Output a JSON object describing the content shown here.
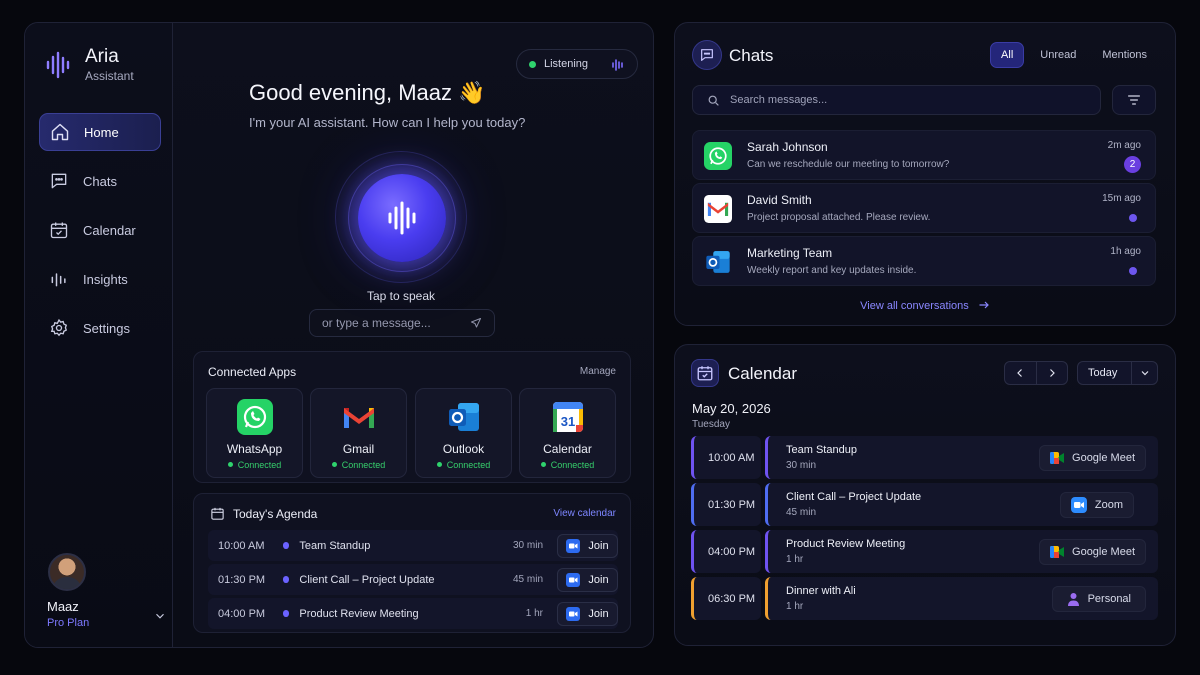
{
  "brand": {
    "name": "Aria",
    "subtitle": "Assistant"
  },
  "nav": [
    {
      "label": "Home",
      "icon": "home-icon",
      "active": true
    },
    {
      "label": "Chats",
      "icon": "chat-icon"
    },
    {
      "label": "Calendar",
      "icon": "calendar-icon"
    },
    {
      "label": "Insights",
      "icon": "bar-chart-icon"
    },
    {
      "label": "Settings",
      "icon": "gear-icon"
    }
  ],
  "user": {
    "name": "Maaz",
    "plan": "Pro Plan"
  },
  "status": {
    "label": "Listening",
    "color": "#2fd36d"
  },
  "greeting": {
    "title": "Good evening, Maaz 👋",
    "subtitle": "I'm your AI assistant. How can I help you today?"
  },
  "voice": {
    "tap_label": "Tap to speak",
    "input_placeholder": "or type a message..."
  },
  "connected_apps": {
    "title": "Connected Apps",
    "manage": "Manage",
    "apps": [
      {
        "name": "WhatsApp",
        "status": "Connected",
        "icon": "whatsapp-icon"
      },
      {
        "name": "Gmail",
        "status": "Connected",
        "icon": "gmail-icon"
      },
      {
        "name": "Outlook",
        "status": "Connected",
        "icon": "outlook-icon"
      },
      {
        "name": "Calendar",
        "status": "Connected",
        "icon": "google-calendar-icon",
        "icon_text": "31"
      }
    ]
  },
  "agenda": {
    "title": "Today's Agenda",
    "link": "View calendar",
    "items": [
      {
        "time": "10:00 AM",
        "title": "Team Standup",
        "duration": "30 min",
        "action": "Join"
      },
      {
        "time": "01:30 PM",
        "title": "Client Call – Project Update",
        "duration": "45 min",
        "action": "Join"
      },
      {
        "time": "04:00 PM",
        "title": "Product Review Meeting",
        "duration": "1 hr",
        "action": "Join"
      }
    ]
  },
  "chats": {
    "title": "Chats",
    "tabs": [
      "All",
      "Unread",
      "Mentions"
    ],
    "active_tab": "All",
    "search_placeholder": "Search messages...",
    "items": [
      {
        "name": "Sarah Johnson",
        "message": "Can we reschedule our meeting to tomorrow?",
        "time": "2m ago",
        "badge": "2",
        "app": "whatsapp-icon"
      },
      {
        "name": "David Smith",
        "message": "Project proposal attached. Please review.",
        "time": "15m ago",
        "app": "gmail-icon"
      },
      {
        "name": "Marketing Team",
        "message": "Weekly report and key updates inside.",
        "time": "1h ago",
        "app": "outlook-icon"
      }
    ],
    "view_all": "View all conversations"
  },
  "calendar": {
    "title": "Calendar",
    "today": "Today",
    "date": "May 20, 2026",
    "weekday": "Tuesday",
    "events": [
      {
        "time": "10:00 AM",
        "title": "Team Standup",
        "duration": "30 min",
        "tag": "Google Meet",
        "tag_icon": "google-meet-icon",
        "color": "#6f53f0"
      },
      {
        "time": "01:30 PM",
        "title": "Client Call – Project Update",
        "duration": "45 min",
        "tag": "Zoom",
        "tag_icon": "zoom-icon",
        "color": "#4f6df0"
      },
      {
        "time": "04:00 PM",
        "title": "Product Review Meeting",
        "duration": "1 hr",
        "tag": "Google Meet",
        "tag_icon": "google-meet-icon",
        "color": "#6f53f0"
      },
      {
        "time": "06:30 PM",
        "title": "Dinner with Ali",
        "duration": "1 hr",
        "tag": "Personal",
        "tag_icon": "person-icon",
        "color": "#f0a030"
      }
    ]
  },
  "colors": {
    "accent": "#5b4df5",
    "connected": "#2fd36d",
    "link": "#8a87ff"
  }
}
